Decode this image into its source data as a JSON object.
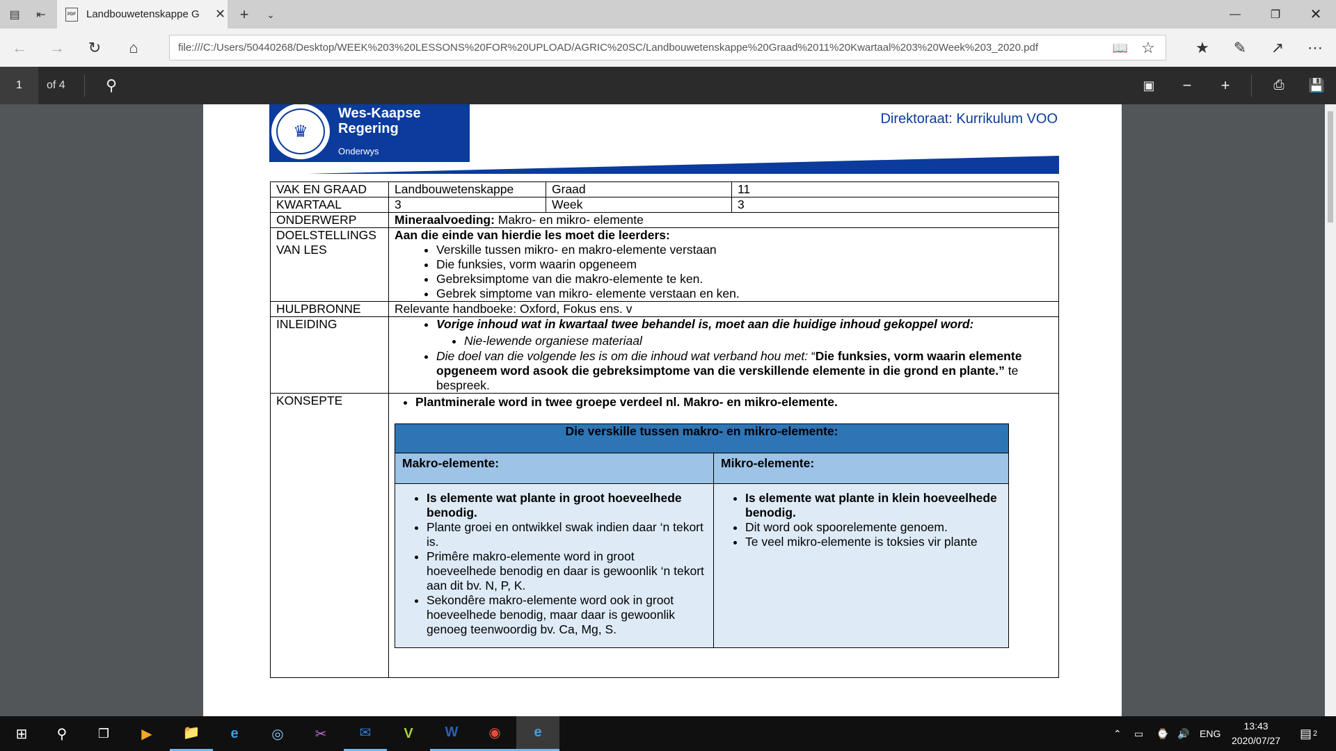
{
  "browser": {
    "tab_title": "Landbouwetenskappe G",
    "url": "file:///C:/Users/50440268/Desktop/WEEK%203%20LESSONS%20FOR%20UPLOAD/AGRIC%20SC/Landbouwetenskappe%20Graad%2011%20Kwartaal%203%20Week%203_2020.pdf"
  },
  "pdf_toolbar": {
    "page_number": "1",
    "page_count": "of 4"
  },
  "header": {
    "logo_line1": "Wes-Kaapse",
    "logo_line2": "Regering",
    "logo_sub": "Onderwys",
    "directorate": "Direktoraat: Kurrikulum VOO",
    "brand_color": "#0b3b9c"
  },
  "lesson": {
    "row1": {
      "label": "VAK EN GRAAD",
      "subject": "Landbouwetenskappe",
      "grade_label": "Graad",
      "grade": "11"
    },
    "row2": {
      "label": "KWARTAAL",
      "term": "3",
      "week_label": "Week",
      "week": "3"
    },
    "topic": {
      "label": "ONDERWERP",
      "bold": "Mineraalvoeding:",
      "text": " Makro- en mikro- elemente"
    },
    "aims": {
      "label_line1": "DOELSTELLINGS",
      "label_line2": "VAN LES",
      "intro": "Aan die einde van hierdie les moet die leerders:",
      "items": [
        "Verskille tussen mikro- en makro-elemente verstaan",
        "Die funksies, vorm waarin opgeneem",
        "Gebreksimptome van die makro-elemente te ken.",
        "Gebrek simptome van mikro- elemente verstaan en ken."
      ]
    },
    "resources": {
      "label": "HULPBRONNE",
      "text": "Relevante handboeke: Oxford, Fokus ens. v"
    },
    "introduction": {
      "label": "INLEIDING",
      "item1": "Vorige inhoud wat in kwartaal twee behandel is, moet aan die huidige inhoud gekoppel word:",
      "subitem": "Nie-lewende organiese materiaal",
      "item2_italic": "Die doel van die volgende les is om die inhoud wat verband hou met: ",
      "item2_quote_open": "“",
      "item2_bold": "Die funksies, vorm waarin elemente opgeneem word asook die gebreksimptome van die verskillende elemente in die grond en plante.”",
      "item2_end": " te bespreek."
    },
    "concepts": {
      "label": "KONSEPTE",
      "lead": "Plantminerale word in twee groepe verdeel nl. Makro- en mikro-elemente.",
      "table_title": "Die verskille tussen makro- en mikro-elemente:",
      "macro_header": "Makro-elemente:",
      "micro_header": "Mikro-elemente:",
      "macro_items": [
        "Is elemente wat plante in groot hoeveelhede benodig.",
        "Plante groei en ontwikkel swak indien daar ‘n tekort is.",
        "Primêre makro-elemente word in groot hoeveelhede benodig en daar is gewoonlik ‘n tekort aan dit bv. N, P, K.",
        "Sekondêre makro-elemente word ook in groot hoeveelhede benodig, maar daar is gewoonlik genoeg teenwoordig bv. Ca, Mg, S."
      ],
      "micro_items": [
        "Is elemente wat plante in klein hoeveelhede benodig.",
        "Dit word ook spoorelemente genoem.",
        "Te veel mikro-elemente is toksies vir plante"
      ],
      "colors": {
        "title_bg": "#2e75b6",
        "header_bg": "#9dc3e6",
        "body_bg": "#deebf7"
      }
    }
  },
  "taskbar": {
    "language": "ENG",
    "time": "13:43",
    "date": "2020/07/27",
    "notification_count": "2"
  }
}
